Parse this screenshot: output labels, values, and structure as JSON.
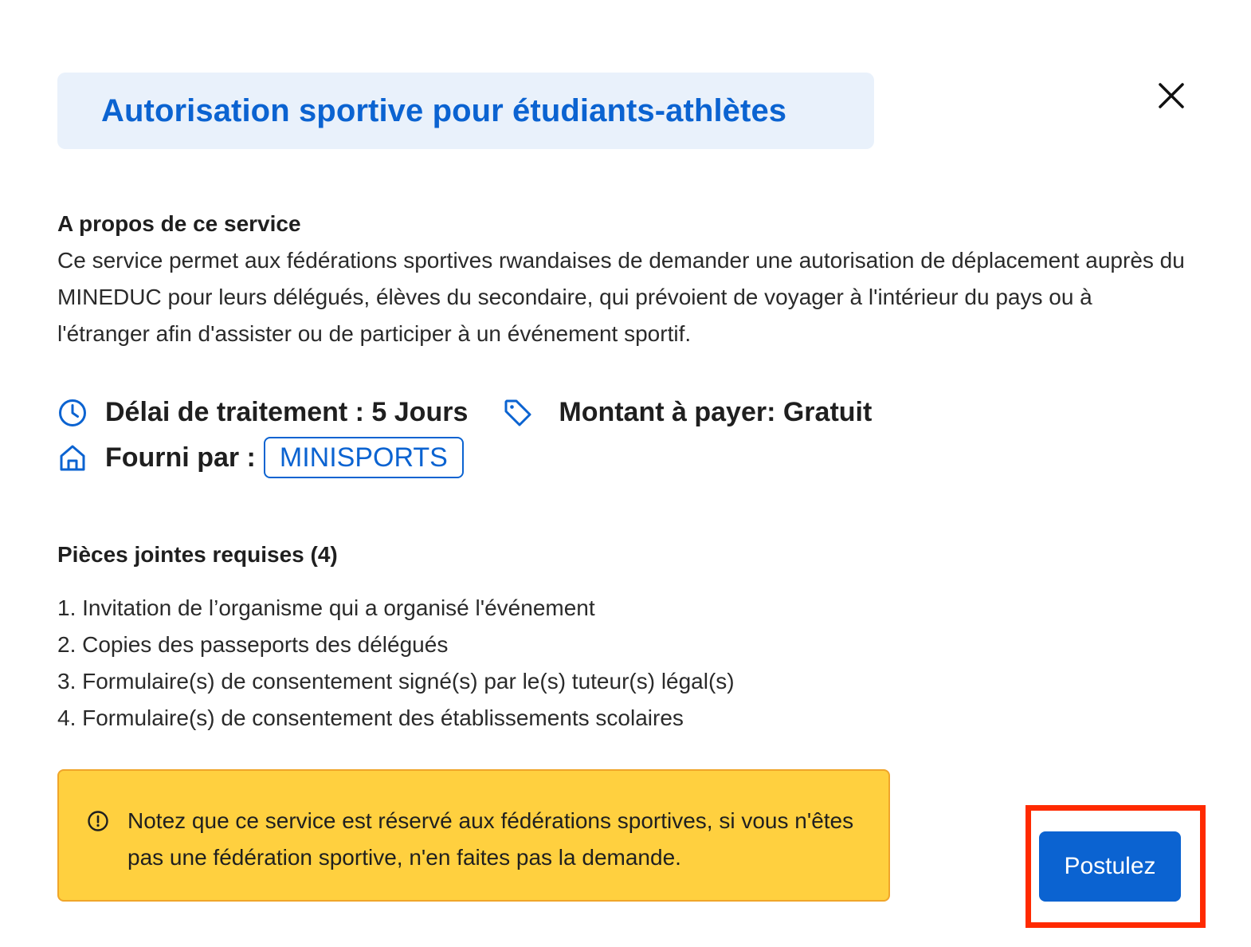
{
  "modal": {
    "title": "Autorisation sportive pour étudiants-athlètes"
  },
  "about": {
    "heading": "A propos de ce service",
    "description": "Ce service permet aux fédérations sportives rwandaises de demander une autorisation de déplacement auprès du MINEDUC pour leurs délégués, élèves du secondaire, qui prévoient de voyager à l'intérieur du pays ou à l'étranger afin d'assister ou de participer à un événement sportif."
  },
  "meta": {
    "processing_label": "Délai de traitement : 5 Jours",
    "amount_label": "Montant à payer: Gratuit",
    "provider_label": "Fourni par :",
    "provider_name": "MINISPORTS",
    "icons": {
      "processing": "clock-icon",
      "amount": "tag-icon",
      "provider": "home-icon"
    }
  },
  "attachments": {
    "heading": "Pièces jointes requises (4)",
    "items": [
      "1. Invitation de l’organisme qui a organisé l'événement",
      "2. Copies des passeports des délégués",
      "3. Formulaire(s) de consentement signé(s) par le(s) tuteur(s) légal(s)",
      "4. Formulaire(s) de consentement des établissements scolaires"
    ]
  },
  "notice": {
    "text": "Notez que ce service est réservé aux fédérations sportives, si vous n'êtes pas une fédération sportive, n'en faites pas la demande.",
    "icon": "info-circle-icon"
  },
  "actions": {
    "apply_label": "Postulez",
    "close_icon": "close-icon"
  },
  "colors": {
    "accent": "#0b63d1",
    "title_bg": "#e9f1fb",
    "notice_bg": "#ffd03f",
    "notice_border": "#f0a52a",
    "highlight": "#ff2a00"
  }
}
